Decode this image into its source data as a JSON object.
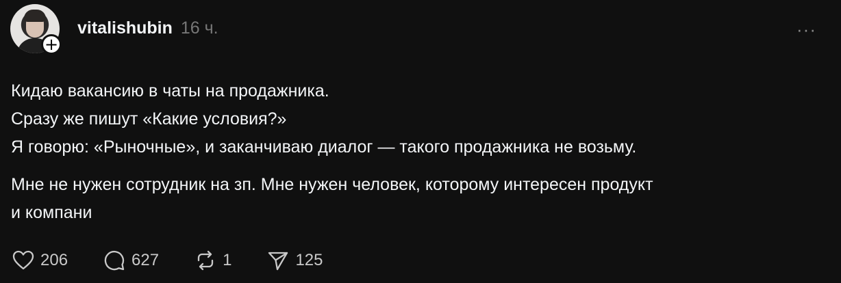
{
  "post": {
    "username": "vitalishubin",
    "time": "16 ч.",
    "more_label": "···",
    "follow_symbol": "+",
    "paragraphs": [
      {
        "lines": [
          "Кидаю вакансию в чаты на продажника.",
          "Сразу же пишут «Какие условия?»",
          "Я говорю: «Рыночные», и заканчиваю диалог — такого продажника не возьму."
        ]
      },
      {
        "lines": [
          "Мне не нужен сотрудник на зп. Мне нужен человек, которому интересен продукт",
          "и компани"
        ]
      }
    ],
    "actions": {
      "likes": {
        "icon": "heart-icon",
        "count": "206"
      },
      "replies": {
        "icon": "comment-icon",
        "count": "627"
      },
      "reposts": {
        "icon": "repost-icon",
        "count": "1"
      },
      "shares": {
        "icon": "send-icon",
        "count": "125"
      }
    }
  },
  "colors": {
    "background": "#101010",
    "text": "#f3f5f7",
    "muted": "#777777",
    "icon": "#c9c9c9"
  }
}
